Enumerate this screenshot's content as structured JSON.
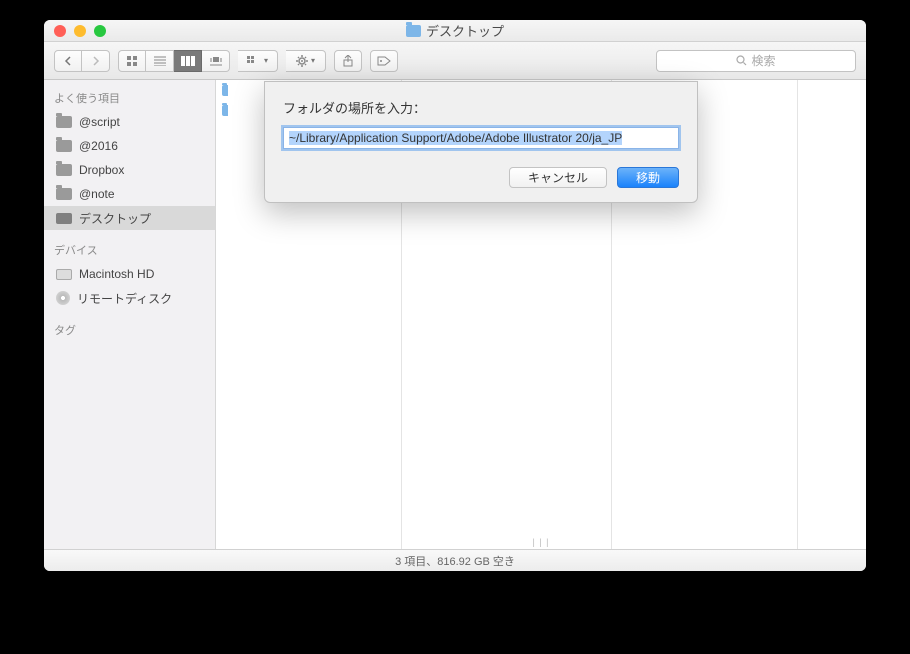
{
  "window": {
    "title": "デスクトップ"
  },
  "toolbar": {
    "search_placeholder": "検索"
  },
  "sidebar": {
    "favorites_header": "よく使う項目",
    "favorites": [
      {
        "label": "@script"
      },
      {
        "label": "@2016"
      },
      {
        "label": "Dropbox"
      },
      {
        "label": "@note"
      },
      {
        "label": "デスクトップ",
        "selected": true
      }
    ],
    "devices_header": "デバイス",
    "devices": [
      {
        "label": "Macintosh HD",
        "kind": "disk"
      },
      {
        "label": "リモートディスク",
        "kind": "cd"
      }
    ],
    "tags_header": "タグ"
  },
  "columns": {
    "col1": [
      {
        "label": ""
      },
      {
        "label": ""
      }
    ]
  },
  "statusbar": {
    "text": "3 項目、816.92 GB 空き"
  },
  "dialog": {
    "label": "フォルダの場所を入力：",
    "value": "~/Library/Application Support/Adobe/Adobe Illustrator 20/ja_JP",
    "cancel": "キャンセル",
    "confirm": "移動"
  }
}
